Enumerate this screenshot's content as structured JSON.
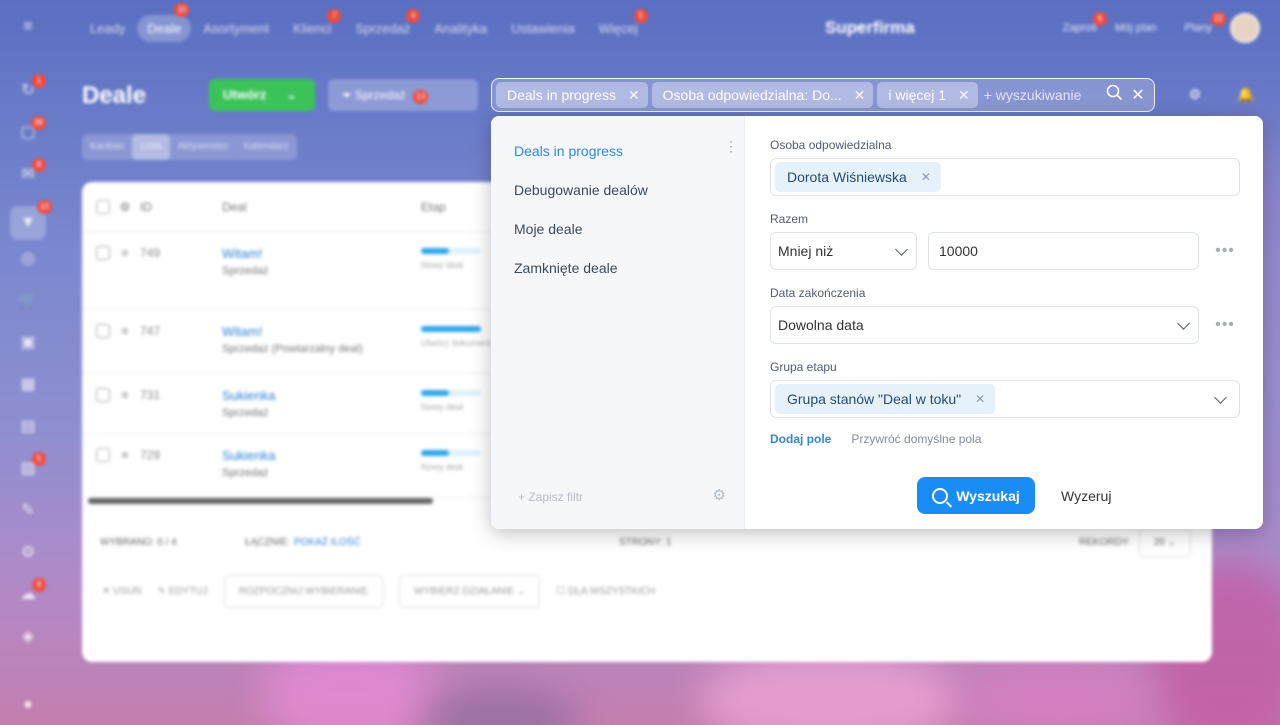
{
  "topnav": {
    "items": [
      {
        "label": "Leady",
        "badge": ""
      },
      {
        "label": "Deale",
        "badge": "10",
        "active": true
      },
      {
        "label": "Asortyment",
        "badge": ""
      },
      {
        "label": "Klienci",
        "badge": "7"
      },
      {
        "label": "Sprzedaż",
        "badge": "4"
      },
      {
        "label": "Analityka",
        "badge": ""
      },
      {
        "label": "Ustawienia",
        "badge": ""
      },
      {
        "label": "Więcej",
        "badge": "5"
      }
    ],
    "brand": "Superfirma",
    "invite": "Zaproś",
    "invite_badge": "6",
    "my_plan": "Mój plan",
    "plans": "Plany",
    "plans_badge": "22"
  },
  "sidebar": {
    "icons": [
      {
        "name": "refresh-icon",
        "glyph": "↻",
        "badge": "1"
      },
      {
        "name": "chat-icon",
        "glyph": "▢",
        "badge": "39"
      },
      {
        "name": "inbox-icon",
        "glyph": "✉",
        "badge": "8"
      },
      {
        "name": "crm-icon",
        "glyph": "▼",
        "badge": "10",
        "active": true
      },
      {
        "name": "target-icon",
        "glyph": "◎",
        "badge": ""
      },
      {
        "name": "cart-icon",
        "glyph": "🛒",
        "badge": ""
      },
      {
        "name": "briefcase-icon",
        "glyph": "▣",
        "badge": ""
      },
      {
        "name": "calendar-icon",
        "glyph": "▦",
        "badge": ""
      },
      {
        "name": "chart-icon",
        "glyph": "▤",
        "badge": ""
      },
      {
        "name": "doc-icon",
        "glyph": "▧",
        "badge": "5"
      },
      {
        "name": "sign-icon",
        "glyph": "✎",
        "badge": ""
      },
      {
        "name": "settings-icon",
        "glyph": "⚙",
        "badge": ""
      },
      {
        "name": "cloud-icon",
        "glyph": "☁",
        "badge": "8"
      },
      {
        "name": "box-icon",
        "glyph": "◈",
        "badge": ""
      }
    ]
  },
  "header": {
    "title": "Deale",
    "create_label": "Utwórz",
    "pipeline_label": "Sprzedaż",
    "pipeline_badge": "13"
  },
  "view_tabs": [
    "Kanban",
    "Lista",
    "Aktywności",
    "Kalendarz"
  ],
  "grid": {
    "columns": [
      "ID",
      "Deal",
      "Etap"
    ],
    "rows": [
      {
        "id": "749",
        "title": "Witam!",
        "sub": "Sprzedaż",
        "stage": "Nowy deal"
      },
      {
        "id": "747",
        "title": "Witam!",
        "sub": "Sprzedaż (Powtarzalny deal)",
        "stage": "Utwórz dokument"
      },
      {
        "id": "731",
        "title": "Sukienka",
        "sub": "Sprzedaż",
        "stage": "Nowy deal"
      },
      {
        "id": "729",
        "title": "Sukienka",
        "sub": "Sprzedaż",
        "stage": "Nowy deal"
      }
    ],
    "selected": "WYBRANO: 0 / 4",
    "total_label": "ŁĄCZNIE:",
    "total_link": "POKAŻ ILOŚĆ",
    "pages": "STRONY: 1",
    "records_label": "REKORDY:",
    "records_value": "20",
    "actions": {
      "delete": "USUŃ",
      "edit": "EDYTUJ",
      "start": "ROZPOCZNIJ WYBIERANIE",
      "choose": "WYBIERZ DZIAŁANIE",
      "all": "DLA WSZYSTKICH"
    }
  },
  "filterbar": {
    "chips": [
      {
        "label": "Deals in progress"
      },
      {
        "label": "Osoba odpowiedzialna: Do..."
      },
      {
        "label": "i więcej 1"
      }
    ],
    "placeholder": "+ wyszukiwanie"
  },
  "popup": {
    "presets": [
      {
        "label": "Deals in progress",
        "active": true
      },
      {
        "label": "Debugowanie dealów"
      },
      {
        "label": "Moje deale"
      },
      {
        "label": "Zamknięte deale"
      }
    ],
    "save_filter": "+ Zapisz filtr",
    "fields": {
      "responsible": {
        "label": "Osoba odpowiedzialna",
        "value": "Dorota Wiśniewska"
      },
      "total": {
        "label": "Razem",
        "operator": "Mniej niż",
        "value": "10000"
      },
      "close_date": {
        "label": "Data zakończenia",
        "value": "Dowolna data"
      },
      "stage_group": {
        "label": "Grupa etapu",
        "value": "Grupa stanów \"Deal w toku\""
      }
    },
    "add_field": "Dodaj pole",
    "restore_fields": "Przywróć domyślne pola",
    "search_btn": "Wyszukaj",
    "reset_btn": "Wyzeruj"
  }
}
